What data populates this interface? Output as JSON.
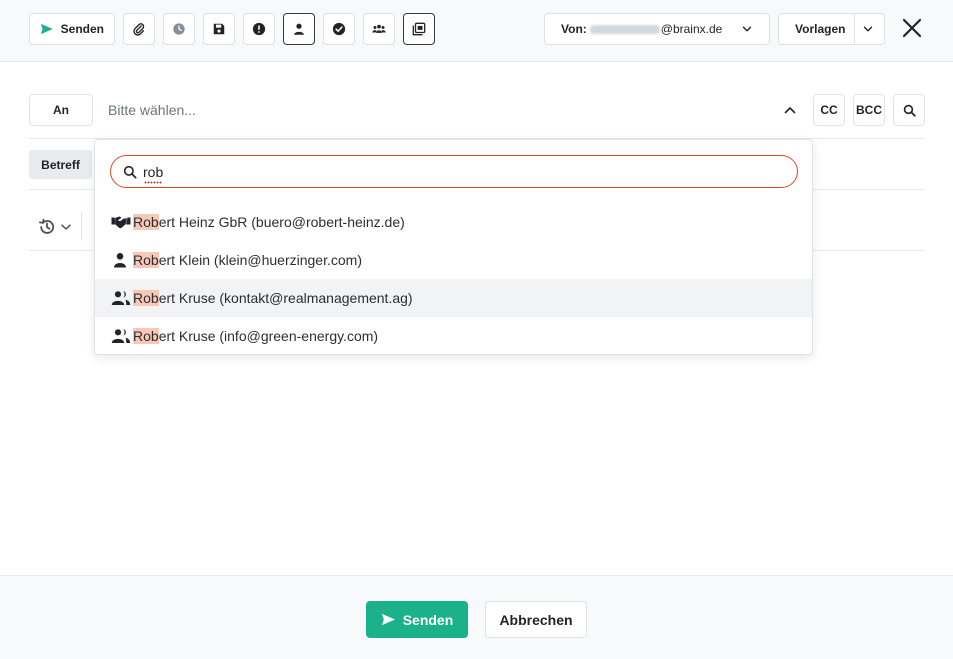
{
  "toolbar": {
    "send_label": "Senden",
    "from_label": "Von:",
    "from_domain": "@brainx.de",
    "templates_label": "Vorlagen",
    "icons": [
      "paperclip-icon",
      "clock-icon",
      "save-icon",
      "priority-icon",
      "contact-icon",
      "check-circle-icon",
      "group-icon",
      "archive-icon",
      "close-icon"
    ]
  },
  "recipient": {
    "to_label": "An",
    "placeholder": "Bitte wählen...",
    "cc_label": "CC",
    "bcc_label": "BCC"
  },
  "subject": {
    "label": "Betreff"
  },
  "dropdown": {
    "search_value": "rob",
    "results": [
      {
        "icon": "handshake-icon",
        "match": "Rob",
        "rest": "ert Heinz GbR (buero@robert-heinz.de)"
      },
      {
        "icon": "person-icon",
        "match": "Rob",
        "rest": "ert Klein (klein@huerzinger.com)"
      },
      {
        "icon": "people-icon",
        "match": "Rob",
        "rest": "ert Kruse (kontakt@realmanagement.ag)"
      },
      {
        "icon": "people-icon",
        "match": "Rob",
        "rest": "ert Kruse (info@green-energy.com)"
      }
    ]
  },
  "footer": {
    "send_label": "Senden",
    "cancel_label": "Abbrechen"
  },
  "colors": {
    "accent": "#1bb18a",
    "search_border": "#dc4c21",
    "highlight": "#f8c7b5"
  }
}
